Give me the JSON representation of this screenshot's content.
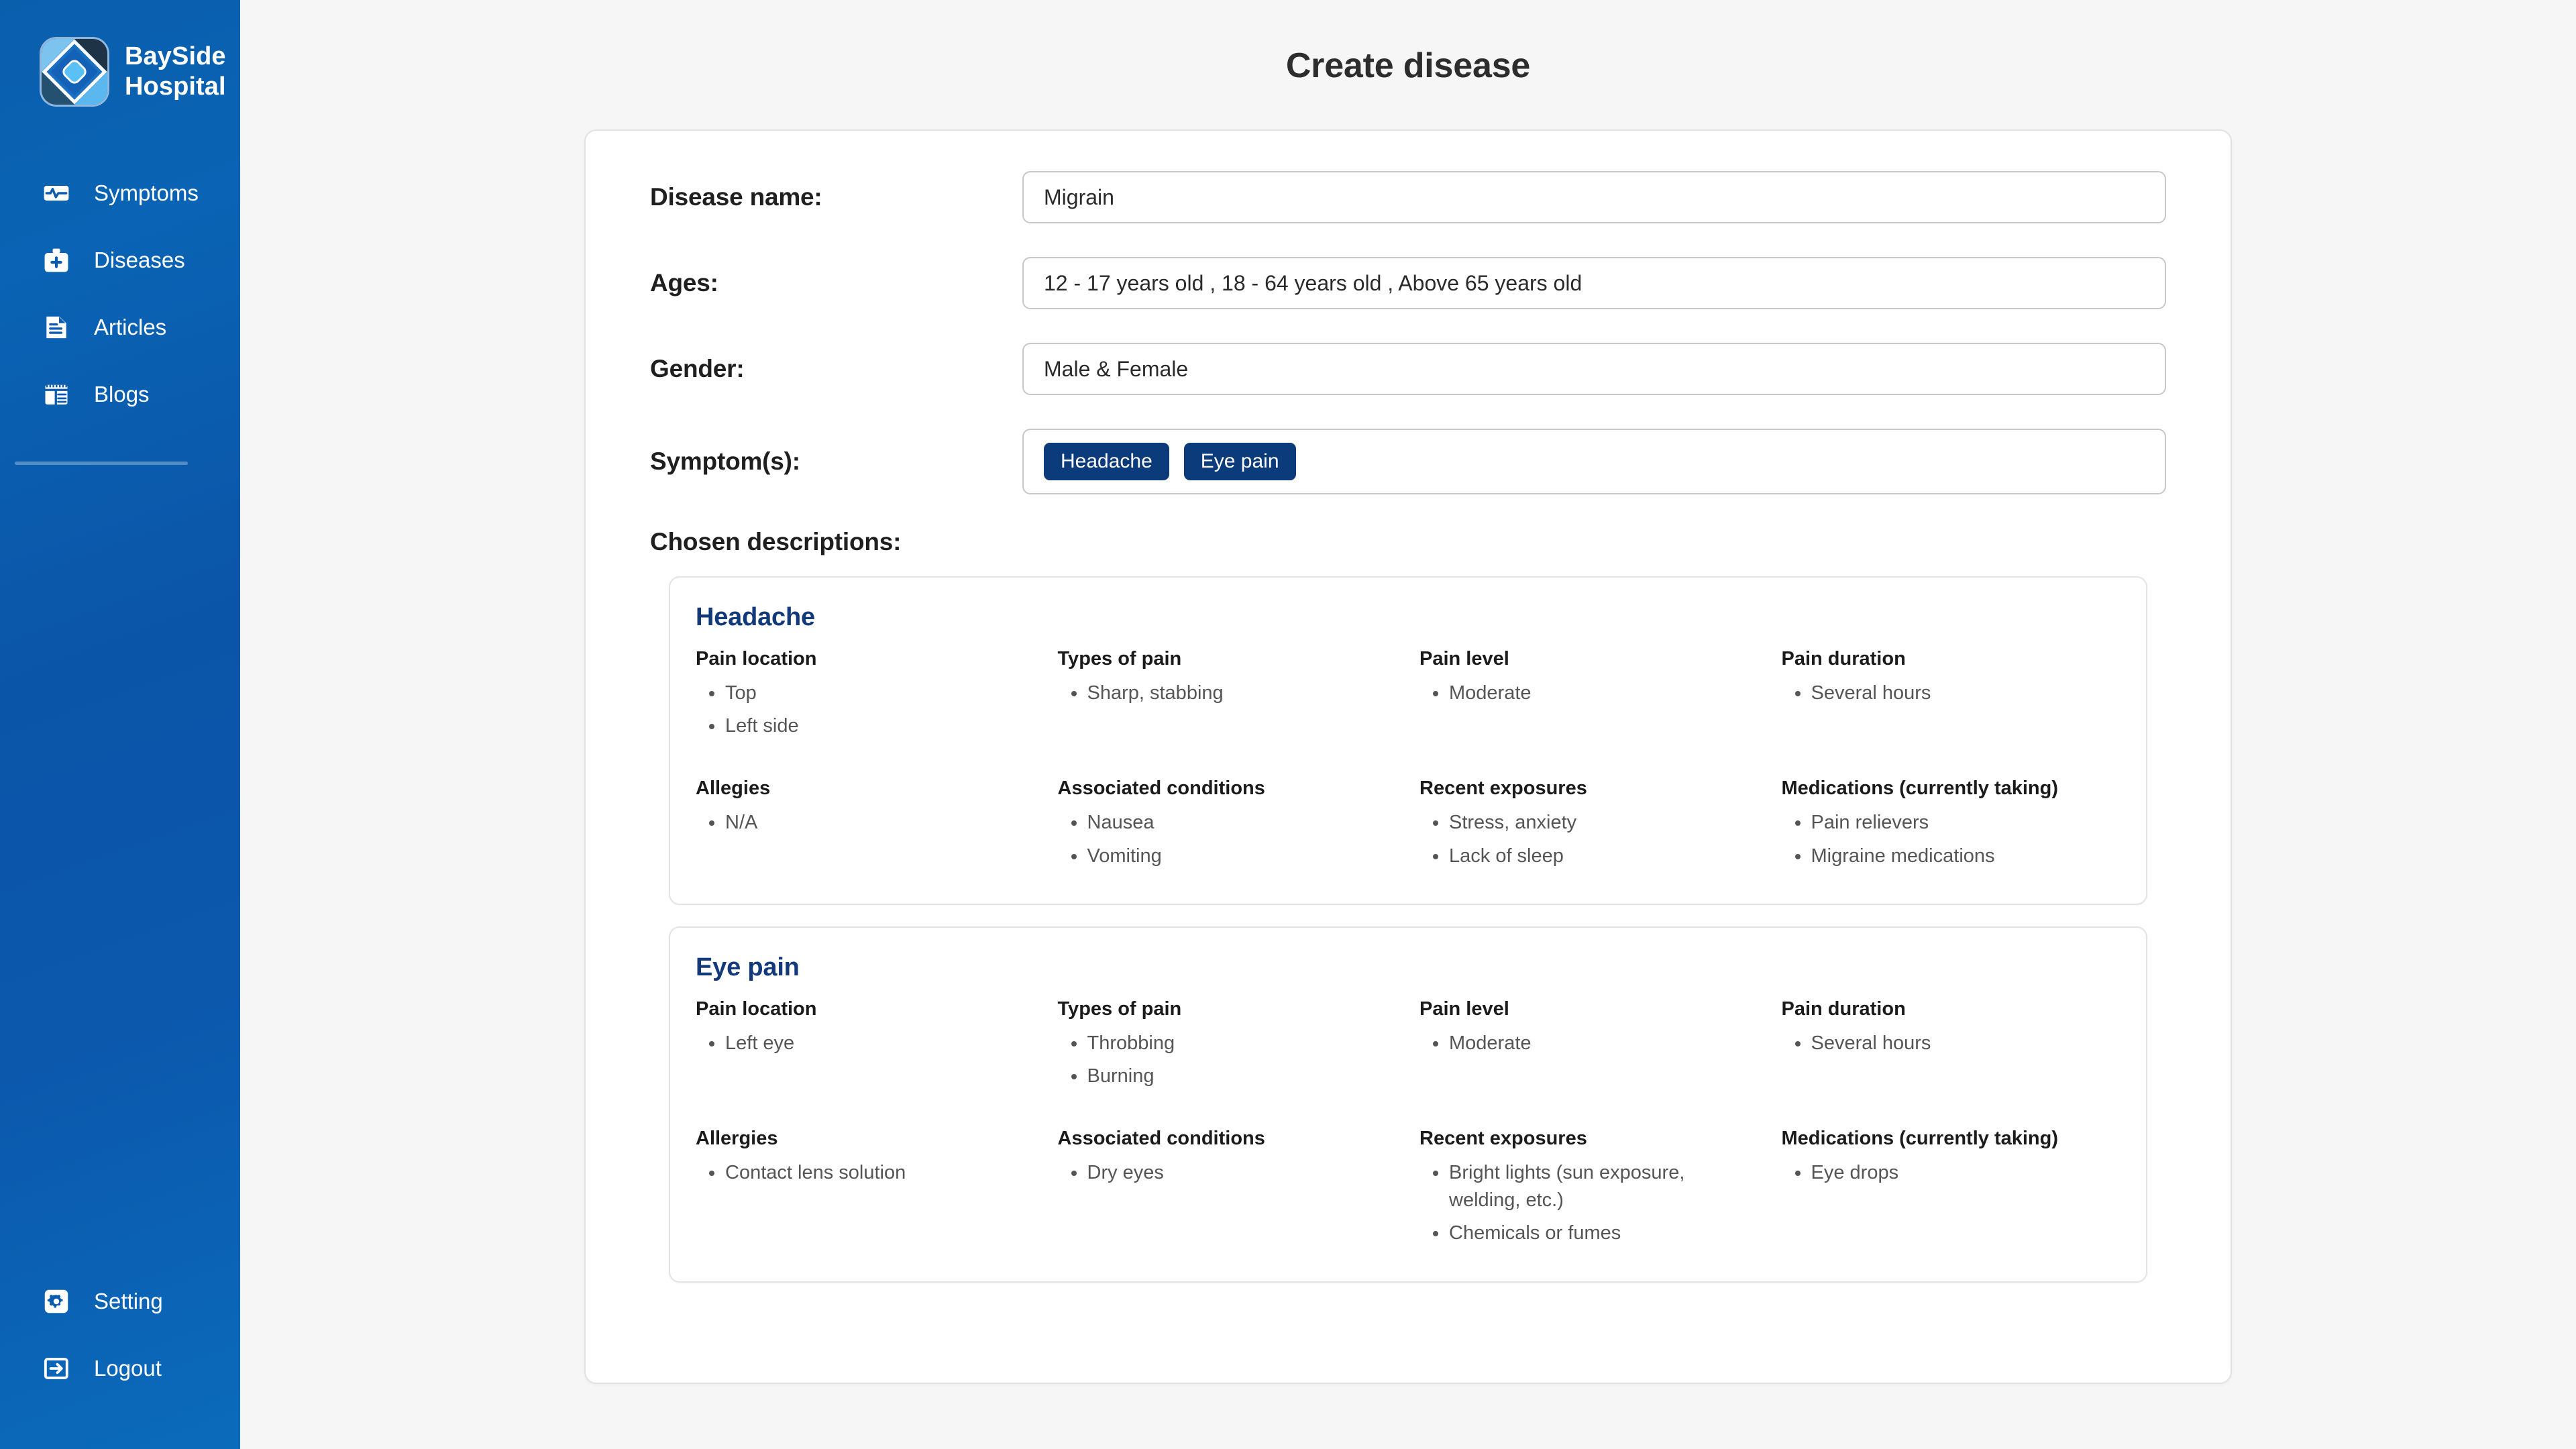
{
  "sidebar": {
    "brand": {
      "name_line1": "BaySide",
      "name_line2": "Hospital",
      "logo_icon": "bayside-diamond-logo"
    },
    "items": [
      {
        "label": "Symptoms",
        "icon": "pulse-activity-icon"
      },
      {
        "label": "Diseases",
        "icon": "medical-briefcase-icon"
      },
      {
        "label": "Articles",
        "icon": "document-text-icon"
      },
      {
        "label": "Blogs",
        "icon": "layout-grid-icon"
      }
    ],
    "bottom_items": [
      {
        "label": "Setting",
        "icon": "gear-icon"
      },
      {
        "label": "Logout",
        "icon": "logout-arrow-icon"
      }
    ]
  },
  "header": {
    "title": "Create disease"
  },
  "form": {
    "disease_name": {
      "label": "Disease name:",
      "value": "Migrain",
      "placeholder": ""
    },
    "ages": {
      "label": "Ages:",
      "value": "12 - 17 years old , 18 - 64 years old , Above 65 years old",
      "placeholder": ""
    },
    "gender": {
      "label": "Gender:",
      "value": "Male & Female",
      "placeholder": ""
    },
    "symptoms": {
      "label": "Symptom(s):",
      "chips": [
        "Headache",
        "Eye pain"
      ]
    }
  },
  "chosen_descriptions": {
    "heading": "Chosen descriptions:",
    "cards": [
      {
        "title": "Headache",
        "fields": [
          {
            "label": "Pain location",
            "items": [
              "Top",
              "Left side"
            ]
          },
          {
            "label": "Types of pain",
            "items": [
              "Sharp, stabbing"
            ]
          },
          {
            "label": "Pain level",
            "items": [
              "Moderate"
            ]
          },
          {
            "label": "Pain duration",
            "items": [
              "Several hours"
            ]
          },
          {
            "label": "Allegies",
            "items": [
              "N/A"
            ]
          },
          {
            "label": "Associated conditions",
            "items": [
              "Nausea",
              "Vomiting"
            ]
          },
          {
            "label": "Recent exposures",
            "items": [
              "Stress, anxiety",
              "Lack of sleep"
            ]
          },
          {
            "label": "Medications (currently taking)",
            "items": [
              "Pain relievers",
              "Migraine medications"
            ]
          }
        ]
      },
      {
        "title": "Eye pain",
        "fields": [
          {
            "label": "Pain location",
            "items": [
              "Left eye"
            ]
          },
          {
            "label": "Types of pain",
            "items": [
              "Throbbing",
              "Burning"
            ]
          },
          {
            "label": "Pain level",
            "items": [
              "Moderate"
            ]
          },
          {
            "label": "Pain duration",
            "items": [
              "Several hours"
            ]
          },
          {
            "label": "Allergies",
            "items": [
              "Contact lens solution"
            ]
          },
          {
            "label": "Associated conditions",
            "items": [
              "Dry eyes"
            ]
          },
          {
            "label": "Recent exposures",
            "items": [
              "Bright lights (sun exposure, welding, etc.)",
              "Chemicals or fumes"
            ]
          },
          {
            "label": "Medications (currently taking)",
            "items": [
              "Eye drops"
            ]
          }
        ]
      }
    ]
  },
  "colors": {
    "sidebar_blue": "#0b5cae",
    "chip_navy": "#0c3b7c",
    "card_title_navy": "#12397a",
    "page_bg": "#f6f6f6"
  }
}
